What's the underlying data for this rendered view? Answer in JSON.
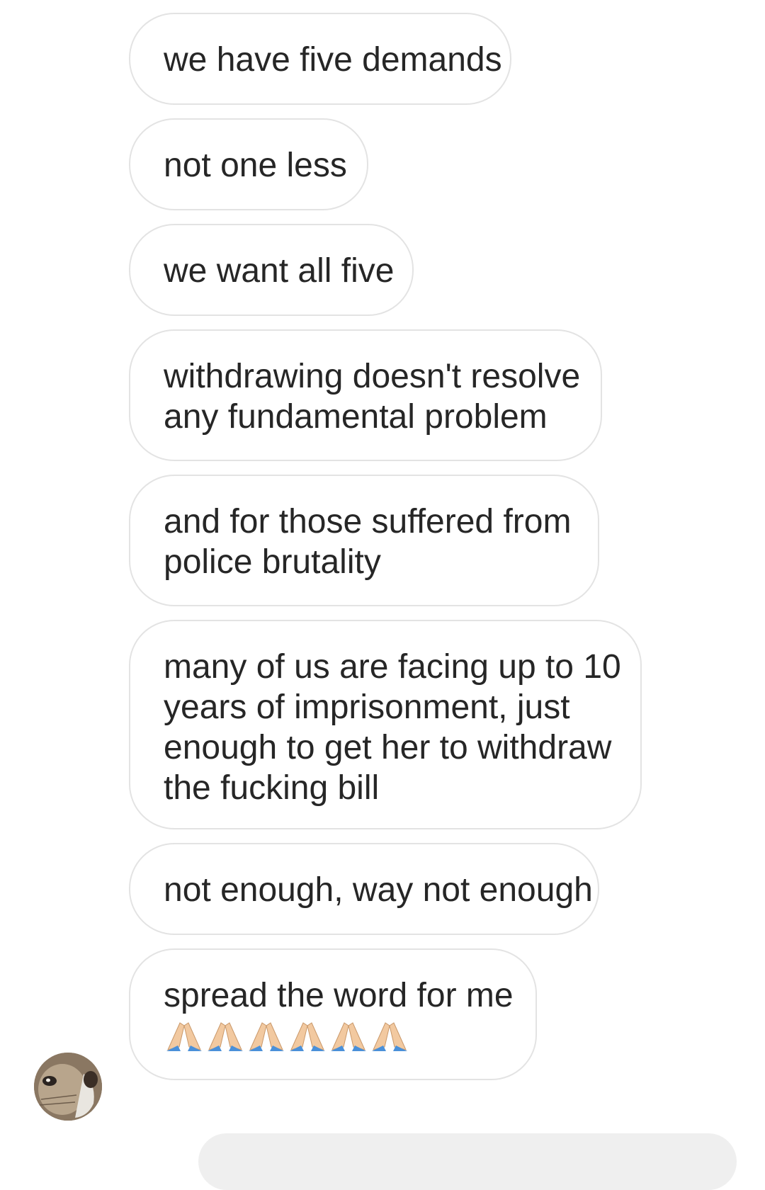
{
  "messages": [
    {
      "lines": [
        "we have five demands"
      ]
    },
    {
      "lines": [
        "not one less"
      ]
    },
    {
      "lines": [
        "we want all five"
      ]
    },
    {
      "lines": [
        "withdrawing doesn't resolve",
        "any fundamental problem"
      ]
    },
    {
      "lines": [
        "and for those suffered from",
        "police brutality"
      ]
    },
    {
      "lines": [
        "many of us are facing up to 10",
        "years of imprisonment, just",
        "enough to get her to withdraw",
        "the fucking bill"
      ]
    },
    {
      "lines": [
        "not enough, way not enough"
      ]
    },
    {
      "lines": [
        "spread the word for me"
      ],
      "emoji": [
        "folded-hands-icon",
        "folded-hands-icon",
        "folded-hands-icon",
        "folded-hands-icon",
        "folded-hands-icon",
        "folded-hands-icon"
      ]
    }
  ],
  "colors": {
    "bubble_border": "#e3e3e3",
    "text": "#262626",
    "composer": "#efefef"
  }
}
